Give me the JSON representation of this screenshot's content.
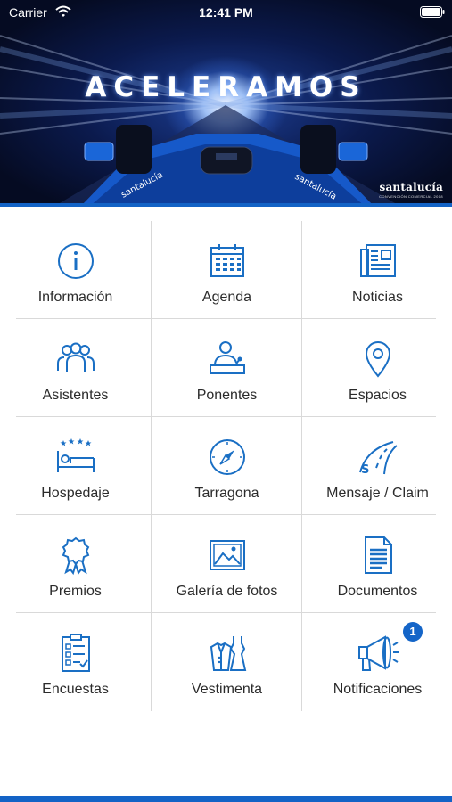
{
  "status_bar": {
    "carrier": "Carrier",
    "time": "12:41 PM"
  },
  "hero": {
    "title": "ACELERAMOS",
    "brand_name": "santalucía",
    "brand_tagline": "CONVENCIÓN COMERCIAL 2018"
  },
  "menu": [
    {
      "label": "Información",
      "icon": "info-icon"
    },
    {
      "label": "Agenda",
      "icon": "calendar-icon"
    },
    {
      "label": "Noticias",
      "icon": "newspaper-icon"
    },
    {
      "label": "Asistentes",
      "icon": "attendees-icon"
    },
    {
      "label": "Ponentes",
      "icon": "speaker-icon"
    },
    {
      "label": "Espacios",
      "icon": "location-pin-icon"
    },
    {
      "label": "Hospedaje",
      "icon": "hotel-bed-icon"
    },
    {
      "label": "Tarragona",
      "icon": "compass-icon"
    },
    {
      "label": "Mensaje / Claim",
      "icon": "road-icon"
    },
    {
      "label": "Premios",
      "icon": "award-ribbon-icon"
    },
    {
      "label": "Galería de fotos",
      "icon": "photo-gallery-icon"
    },
    {
      "label": "Documentos",
      "icon": "document-icon"
    },
    {
      "label": "Encuestas",
      "icon": "survey-checklist-icon"
    },
    {
      "label": "Vestimenta",
      "icon": "clothing-icon"
    },
    {
      "label": "Notificaciones",
      "icon": "megaphone-icon",
      "badge": "1"
    }
  ],
  "colors": {
    "accent": "#1465c8",
    "icon_blue": "#1a6fc4",
    "label": "#2b2b2b",
    "divider": "#d9d9d9"
  }
}
